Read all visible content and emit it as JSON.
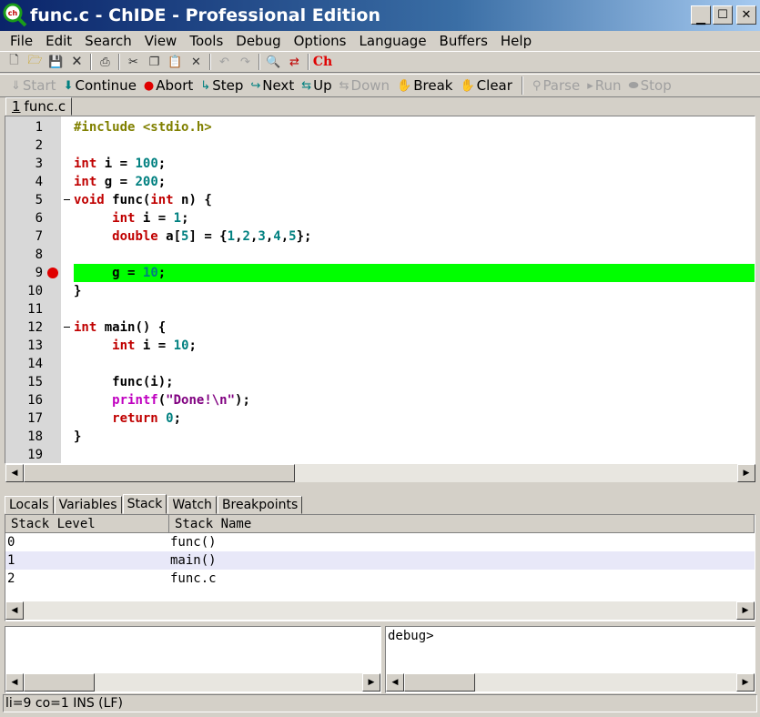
{
  "window": {
    "title": "func.c - ChIDE - Professional Edition"
  },
  "menu": [
    "File",
    "Edit",
    "Search",
    "View",
    "Tools",
    "Debug",
    "Options",
    "Language",
    "Buffers",
    "Help"
  ],
  "debug_toolbar": {
    "start": "Start",
    "continue": "Continue",
    "abort": "Abort",
    "step": "Step",
    "next": "Next",
    "up": "Up",
    "down": "Down",
    "break": "Break",
    "clear": "Clear",
    "parse": "Parse",
    "run": "Run",
    "stop": "Stop"
  },
  "file_tab": {
    "index": "1",
    "name": "func.c"
  },
  "editor": {
    "current_line": 9,
    "breakpoint_line": 9,
    "lines": [
      "1",
      "2",
      "3",
      "4",
      "5",
      "6",
      "7",
      "8",
      "9",
      "10",
      "11",
      "12",
      "13",
      "14",
      "15",
      "16",
      "17",
      "18",
      "19"
    ]
  },
  "debug_tabs": [
    "Locals",
    "Variables",
    "Stack",
    "Watch",
    "Breakpoints"
  ],
  "active_debug_tab": "Stack",
  "stack": {
    "headers": [
      "Stack Level",
      "Stack Name"
    ],
    "rows": [
      {
        "level": "0",
        "name": "func()"
      },
      {
        "level": "1",
        "name": "main()"
      },
      {
        "level": "2",
        "name": "func.c"
      }
    ]
  },
  "console": {
    "prompt": "debug>"
  },
  "status": "li=9 co=1 INS (LF)",
  "colors": {
    "highlight": "#00ff00",
    "breakpoint": "#e00000",
    "keyword": "#c00000",
    "number": "#008080"
  }
}
